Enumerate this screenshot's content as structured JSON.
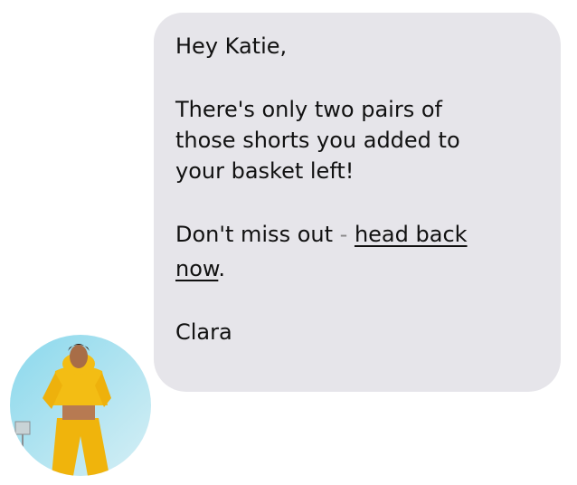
{
  "message": {
    "greeting": "Hey Katie,",
    "body_lines": [
      "There's only two pairs of",
      "those shorts you added to",
      "your basket left!"
    ],
    "cta_prefix": "Don't miss out ",
    "cta_separator": "-",
    "cta_link_part1": "head back",
    "cta_link_part2": "now",
    "cta_suffix": ".",
    "signature": "Clara"
  },
  "avatar": {
    "icon": "sender-avatar-photo",
    "colors": {
      "sky": "#7fd1e6",
      "outfit": "#f2b90f"
    }
  },
  "colors": {
    "bubble": "#e6e5ea",
    "text": "#111111"
  }
}
